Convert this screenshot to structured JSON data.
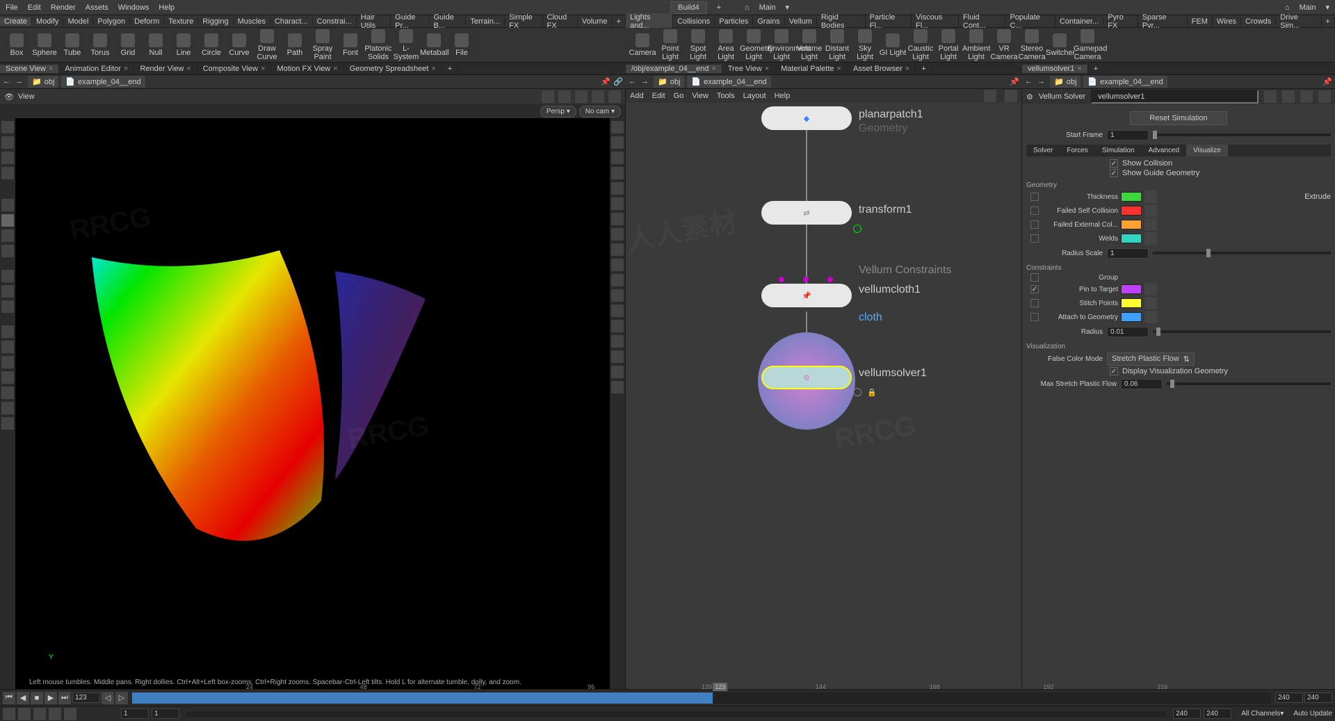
{
  "menu": [
    "File",
    "Edit",
    "Render",
    "Assets",
    "Windows",
    "Help"
  ],
  "build": "Build4",
  "mainDesk": "Main",
  "shelfTabs1": [
    "Create",
    "Modify",
    "Model",
    "Polygon",
    "Deform",
    "Texture",
    "Rigging",
    "Muscles",
    "Charact...",
    "Constrai...",
    "Hair Utils",
    "Guide Pr...",
    "Guide B...",
    "Terrain...",
    "Simple FX",
    "Cloud FX",
    "Volume"
  ],
  "shelfTabs2": [
    "Lights and...",
    "Collisions",
    "Particles",
    "Grains",
    "Vellum",
    "Rigid Bodies",
    "Particle Fl...",
    "Viscous Fl...",
    "Fluid Cont...",
    "Populate C...",
    "Container...",
    "Pyro FX",
    "Sparse Pyr...",
    "FEM",
    "Wires",
    "Crowds",
    "Drive Sim..."
  ],
  "tools1": [
    {
      "name": "box",
      "label": "Box"
    },
    {
      "name": "sphere",
      "label": "Sphere"
    },
    {
      "name": "tube",
      "label": "Tube"
    },
    {
      "name": "torus",
      "label": "Torus"
    },
    {
      "name": "grid",
      "label": "Grid"
    },
    {
      "name": "null",
      "label": "Null"
    },
    {
      "name": "line",
      "label": "Line"
    },
    {
      "name": "circle",
      "label": "Circle"
    },
    {
      "name": "curve",
      "label": "Curve"
    },
    {
      "name": "drawcurve",
      "label": "Draw Curve"
    },
    {
      "name": "path",
      "label": "Path"
    },
    {
      "name": "spraypaint",
      "label": "Spray Paint"
    },
    {
      "name": "font",
      "label": "Font"
    },
    {
      "name": "platonic",
      "label": "Platonic Solids"
    },
    {
      "name": "lsystem",
      "label": "L-System"
    },
    {
      "name": "metaball",
      "label": "Metaball"
    },
    {
      "name": "file",
      "label": "File"
    }
  ],
  "tools2": [
    {
      "name": "camera",
      "label": "Camera"
    },
    {
      "name": "pointlight",
      "label": "Point Light"
    },
    {
      "name": "spotlight",
      "label": "Spot Light"
    },
    {
      "name": "arealight",
      "label": "Area Light"
    },
    {
      "name": "geolight",
      "label": "Geometry Light"
    },
    {
      "name": "envlight",
      "label": "Environment Light"
    },
    {
      "name": "volumelight",
      "label": "Volume Light"
    },
    {
      "name": "distantlight",
      "label": "Distant Light"
    },
    {
      "name": "skylight",
      "label": "Sky Light"
    },
    {
      "name": "gilight",
      "label": "GI Light"
    },
    {
      "name": "causticlight",
      "label": "Caustic Light"
    },
    {
      "name": "portallight",
      "label": "Portal Light"
    },
    {
      "name": "ambientlight",
      "label": "Ambient Light"
    },
    {
      "name": "vrcamera",
      "label": "VR Camera"
    },
    {
      "name": "stereocam",
      "label": "Stereo Camera"
    },
    {
      "name": "switcher",
      "label": "Switcher"
    },
    {
      "name": "gamepadcam",
      "label": "Gamepad Camera"
    }
  ],
  "leftPaneTabs": [
    "Scene View",
    "Animation Editor",
    "Render View",
    "Composite View",
    "Motion FX View",
    "Geometry Spreadsheet"
  ],
  "midPaneTabs": [
    "/obj/example_04__end",
    "Tree View",
    "Material Palette",
    "Asset Browser"
  ],
  "rightPaneTabs": [
    "vellumsolver1"
  ],
  "path": {
    "obj": "obj",
    "node": "example_04__end"
  },
  "viewLabel": "View",
  "persp": "Persp ▾",
  "nocam": "No cam ▾",
  "hint": "Left mouse tumbles. Middle pans. Right dollies. Ctrl+Alt+Left box-zooms. Ctrl+Right zooms. Spacebar-Ctrl-Left tilts. Hold L for alternate tumble, dolly, and zoom.",
  "netMenu": [
    "Add",
    "Edit",
    "Go",
    "View",
    "Tools",
    "Layout",
    "Help"
  ],
  "nodes": {
    "n1": "planarpatch1",
    "n2": "transform1",
    "n3": "vellumcloth1",
    "n3b": "cloth",
    "n3grp": "Vellum Constraints",
    "n4": "vellumsolver1",
    "n1grp": "Geometry"
  },
  "parm": {
    "type": "Vellum Solver",
    "name": "vellumsolver1",
    "reset": "Reset Simulation",
    "startFrame": "Start Frame",
    "startFrameVal": "1",
    "tabs": [
      "Solver",
      "Forces",
      "Simulation",
      "Advanced",
      "Visualize"
    ],
    "showCollision": "Show Collision",
    "showGuide": "Show Guide Geometry",
    "geoSection": "Geometry",
    "thickness": "Thickness",
    "failedSelf": "Failed Self Collision",
    "failedExt": "Failed External Col...",
    "welds": "Welds",
    "radiusScale": "Radius Scale",
    "radiusScaleVal": "1",
    "extrude": "Extrude",
    "constraintsSection": "Constraints",
    "group": "Group",
    "pinTarget": "Pin to Target",
    "stitchPoints": "Stitch Points",
    "attachGeo": "Attach to Geometry",
    "radius": "Radius",
    "radiusVal": "0.01",
    "visSection": "Visualization",
    "falseColor": "False Color Mode",
    "falseColorVal": "Stretch Plastic Flow",
    "displayVis": "Display Visualization Geometry",
    "maxStretch": "Max Stretch Plastic Flow",
    "maxStretchVal": "0.06",
    "colors": {
      "thickness": "#3dd63d",
      "failedSelf": "#ff3030",
      "failedExt": "#ffa030",
      "welds": "#30d6c0",
      "pinTarget": "#c040ff",
      "stitchPoints": "#ffff30",
      "attachGeo": "#40a0ff"
    }
  },
  "timeline": {
    "cur": "123",
    "start": "1",
    "end": "240",
    "marks": [
      "64",
      "184",
      "298",
      "413",
      "523",
      "639",
      "752",
      "865",
      "979",
      "1091",
      "1205"
    ],
    "markLabels": [
      "24",
      "48",
      "72",
      "96",
      "120",
      "144",
      "168",
      "192",
      "216"
    ],
    "autoUpdate": "Auto Update",
    "allChannels": "All Channels▾"
  }
}
